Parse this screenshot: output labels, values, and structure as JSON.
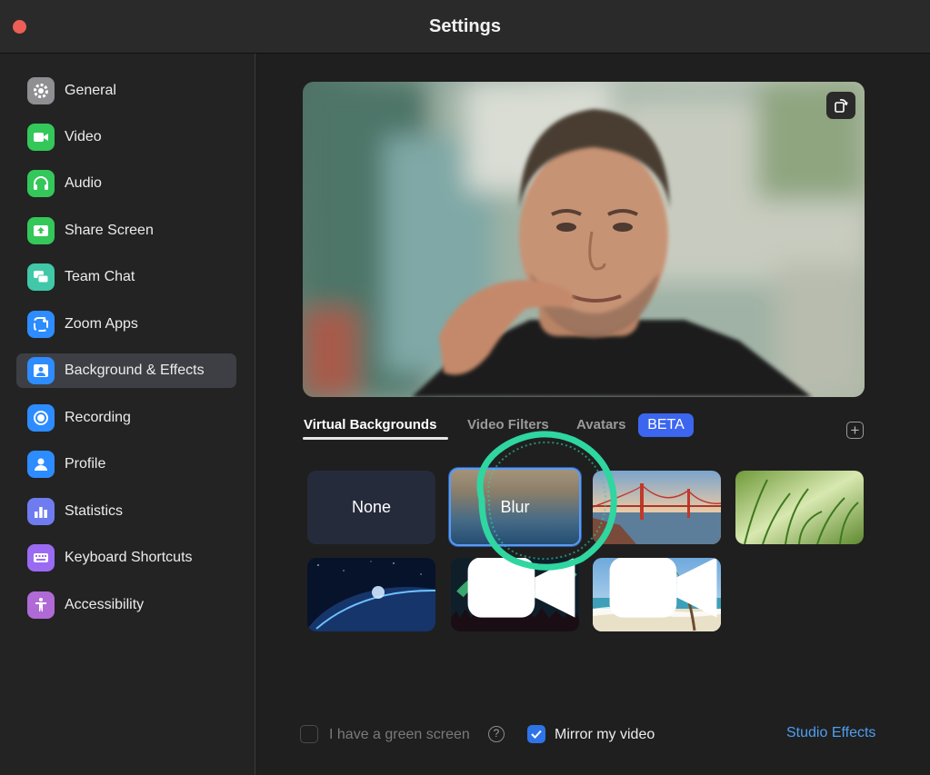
{
  "window": {
    "title": "Settings"
  },
  "sidebar": {
    "items": [
      {
        "label": "General",
        "icon": "gear-icon",
        "color": "#8e8e93",
        "active": false
      },
      {
        "label": "Video",
        "icon": "camera-icon",
        "color": "#34c759",
        "active": false
      },
      {
        "label": "Audio",
        "icon": "headphones-icon",
        "color": "#34c759",
        "active": false
      },
      {
        "label": "Share Screen",
        "icon": "share-screen-icon",
        "color": "#34c759",
        "active": false
      },
      {
        "label": "Team Chat",
        "icon": "chat-icon",
        "color": "#40c8a8",
        "active": false
      },
      {
        "label": "Zoom Apps",
        "icon": "apps-icon",
        "color": "#2d8cff",
        "active": false
      },
      {
        "label": "Background & Effects",
        "icon": "portrait-icon",
        "color": "#2d8cff",
        "active": true
      },
      {
        "label": "Recording",
        "icon": "record-icon",
        "color": "#2d8cff",
        "active": false
      },
      {
        "label": "Profile",
        "icon": "user-icon",
        "color": "#2d8cff",
        "active": false
      },
      {
        "label": "Statistics",
        "icon": "bar-chart-icon",
        "color": "#6e7cf0",
        "active": false
      },
      {
        "label": "Keyboard Shortcuts",
        "icon": "keyboard-icon",
        "color": "#9b6af2",
        "active": false
      },
      {
        "label": "Accessibility",
        "icon": "accessibility-icon",
        "color": "#b06ad6",
        "active": false
      }
    ]
  },
  "tabs": [
    {
      "label": "Virtual Backgrounds",
      "active": true
    },
    {
      "label": "Video Filters",
      "active": false
    },
    {
      "label": "Avatars",
      "active": false
    }
  ],
  "beta_badge": "BETA",
  "backgrounds": [
    {
      "label": "None",
      "kind": "none"
    },
    {
      "label": "Blur",
      "kind": "blur",
      "selected": true
    },
    {
      "label": "",
      "kind": "golden-gate"
    },
    {
      "label": "",
      "kind": "grass"
    },
    {
      "label": "",
      "kind": "earth"
    },
    {
      "label": "",
      "kind": "aurora",
      "video": true
    },
    {
      "label": "",
      "kind": "beach",
      "video": true
    }
  ],
  "footer": {
    "green_screen_label": "I have a green screen",
    "green_screen_checked": false,
    "mirror_label": "Mirror my video",
    "mirror_checked": true,
    "studio_effects_label": "Studio Effects"
  },
  "colors": {
    "accent": "#2e74e8",
    "link": "#4f9ef0",
    "beta": "#3c66f0",
    "selection_ring": "#2fd6a0"
  }
}
